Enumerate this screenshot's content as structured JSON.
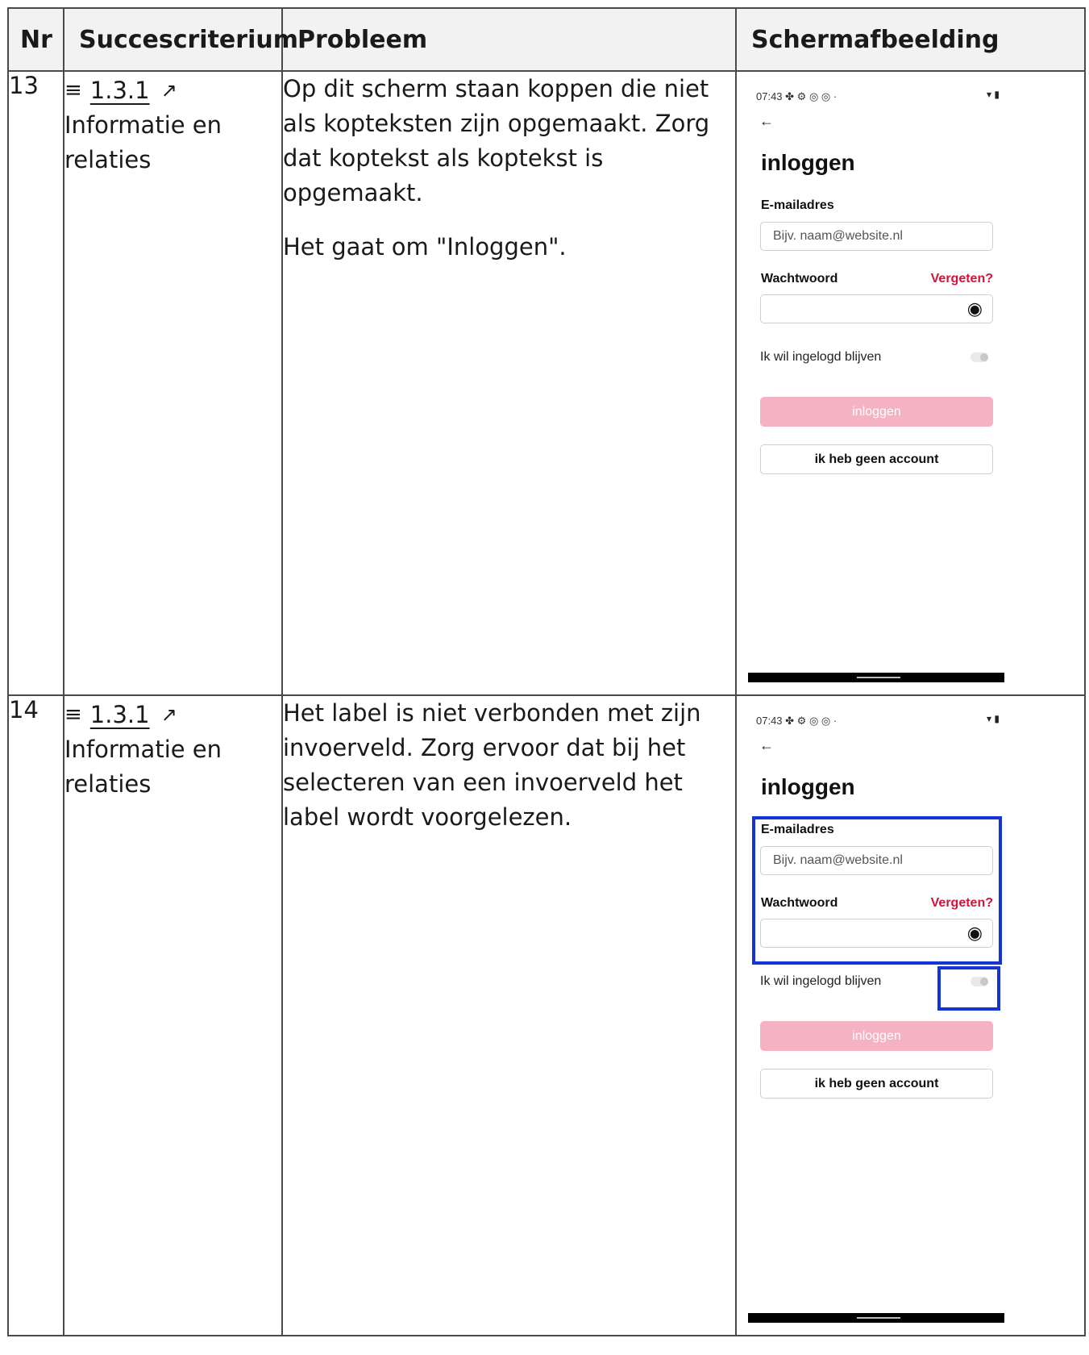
{
  "table": {
    "headers": {
      "nr": "Nr",
      "criterion": "Succescriterium",
      "problem": "Probleem",
      "screenshot": "Schermafbeelding"
    }
  },
  "rows": [
    {
      "nr": "13",
      "criterion_code": "1.3.1",
      "criterion_name": "Informatie en relaties",
      "problem_p1": "Op dit scherm staan koppen die niet als kopteksten zijn opgemaakt. Zorg dat koptekst als koptekst is opgemaakt.",
      "problem_p2": "Het gaat om \"Inloggen\"."
    },
    {
      "nr": "14",
      "criterion_code": "1.3.1",
      "criterion_name": "Informatie en relaties",
      "problem_p1": "Het label is niet verbonden met zijn invoerveld. Zorg ervoor dat bij het selecteren van een invoerveld het label wordt voorgelezen."
    }
  ],
  "phone": {
    "time": "07:43",
    "status_icons": "✤ ⚙ ◎ ◎ ·",
    "status_right": "▾ ▮",
    "back_icon": "←",
    "title": "inloggen",
    "email_label": "E-mailadres",
    "email_placeholder": "Bijv. naam@website.nl",
    "password_label": "Wachtwoord",
    "forgot_link": "Vergeten?",
    "eye_icon": "◉",
    "stay_logged_in": "Ik wil ingelogd blijven",
    "login_button": "inloggen",
    "no_account_button": "ik heb geen account"
  },
  "icons": {
    "list": "list-icon",
    "external_link": "external-link-icon"
  },
  "colors": {
    "highlight": "#1533d6",
    "brand_red": "#d4123a",
    "login_button_disabled": "#f5b2c3"
  }
}
